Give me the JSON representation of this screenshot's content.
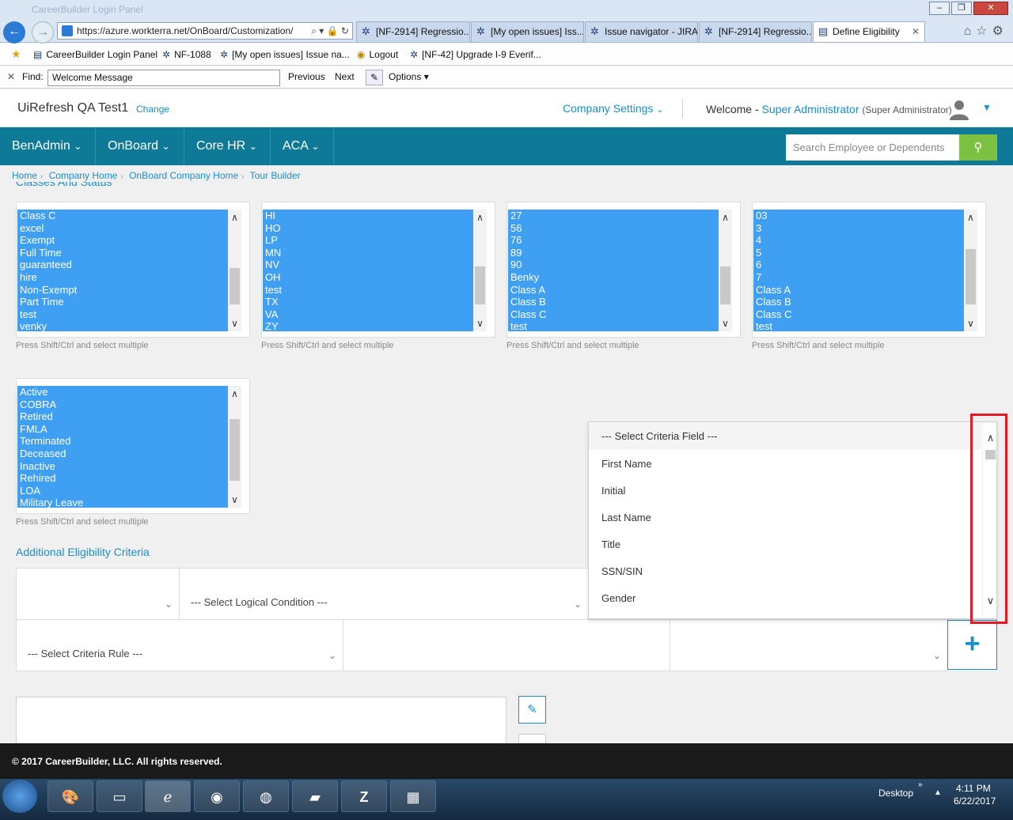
{
  "browser": {
    "faded_title": "CareerBuilder Login Panel",
    "url": "https://azure.workterra.net/OnBoard/Customization/",
    "tabs": [
      {
        "label": "[NF-2914] Regressio..."
      },
      {
        "label": "[My open issues] Iss..."
      },
      {
        "label": "Issue navigator - JIRA"
      },
      {
        "label": "[NF-2914] Regressio..."
      },
      {
        "label": "Define Eligibility"
      }
    ],
    "favorites": [
      {
        "label": "CareerBuilder Login Panel"
      },
      {
        "label": "NF-1088"
      },
      {
        "label": "[My open issues] Issue na..."
      },
      {
        "label": "Logout"
      },
      {
        "label": "[NF-42] Upgrade I-9 Everif..."
      }
    ],
    "find": {
      "label": "Find:",
      "value": "Welcome Message",
      "previous": "Previous",
      "next": "Next",
      "options": "Options"
    }
  },
  "header": {
    "company": "UiRefresh QA Test1",
    "change": "Change",
    "company_settings": "Company Settings",
    "welcome_prefix": "Welcome -",
    "user_name": "Super Administrator",
    "user_role": "(Super Administrator)"
  },
  "nav": {
    "items": [
      {
        "label": "BenAdmin"
      },
      {
        "label": "OnBoard"
      },
      {
        "label": "Core HR"
      },
      {
        "label": "ACA"
      }
    ],
    "search_placeholder": "Search Employee or Dependents"
  },
  "breadcrumb": [
    "Home",
    "Company Home",
    "OnBoard Company Home",
    "Tour Builder"
  ],
  "section_title_cut": "Classes And Status",
  "listboxes": [
    {
      "items": [
        "Class C",
        "excel",
        "Exempt",
        "Full Time",
        "guaranteed",
        "hire",
        "Non-Exempt",
        "Part Time",
        "test",
        "venky"
      ]
    },
    {
      "items": [
        "HI",
        "HO",
        "LP",
        "MN",
        "NV",
        "OH",
        "test",
        "TX",
        "VA",
        "ZY"
      ]
    },
    {
      "items": [
        "27",
        "56",
        "76",
        "89",
        "90",
        "Benky",
        "Class A",
        "Class B",
        "Class C",
        "test"
      ]
    },
    {
      "items": [
        "03",
        "3",
        "4",
        "5",
        "6",
        "7",
        "Class A",
        "Class B",
        "Class C",
        "test"
      ]
    },
    {
      "items": [
        "Active",
        "COBRA",
        "Retired",
        "FMLA",
        "Terminated",
        "Deceased",
        "Inactive",
        "Rehired",
        "LOA",
        "Military Leave"
      ]
    }
  ],
  "hint": "Press Shift/Ctrl and select multiple",
  "additional": {
    "title": "Additional Eligibility Criteria",
    "logical_placeholder": "--- Select Logical Condition ---",
    "rule_placeholder": "--- Select Criteria Rule ---"
  },
  "dropdown": {
    "items": [
      "--- Select Criteria Field ---",
      "First Name",
      "Initial",
      "Last Name",
      "Title",
      "SSN/SIN",
      "Gender"
    ]
  },
  "footer": "© 2017 CareerBuilder, LLC. All rights reserved.",
  "taskbar": {
    "desktop": "Desktop",
    "time": "4:11 PM",
    "date": "6/22/2017"
  }
}
